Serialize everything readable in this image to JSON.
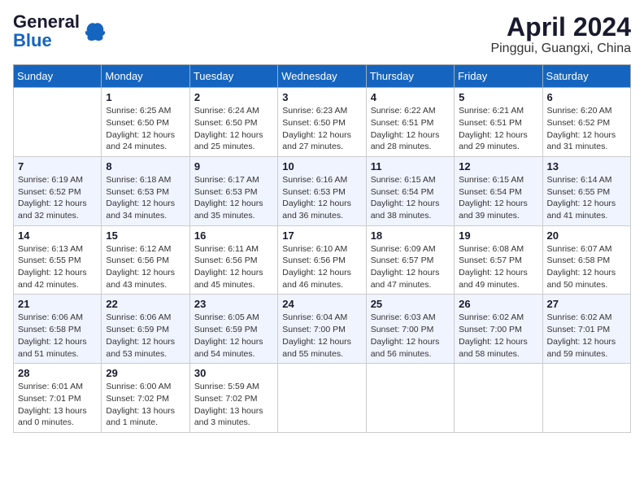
{
  "logo": {
    "general": "General",
    "blue": "Blue"
  },
  "title": {
    "month": "April 2024",
    "location": "Pinggui, Guangxi, China"
  },
  "headers": [
    "Sunday",
    "Monday",
    "Tuesday",
    "Wednesday",
    "Thursday",
    "Friday",
    "Saturday"
  ],
  "weeks": [
    [
      {
        "day": "",
        "info": ""
      },
      {
        "day": "1",
        "info": "Sunrise: 6:25 AM\nSunset: 6:50 PM\nDaylight: 12 hours\nand 24 minutes."
      },
      {
        "day": "2",
        "info": "Sunrise: 6:24 AM\nSunset: 6:50 PM\nDaylight: 12 hours\nand 25 minutes."
      },
      {
        "day": "3",
        "info": "Sunrise: 6:23 AM\nSunset: 6:50 PM\nDaylight: 12 hours\nand 27 minutes."
      },
      {
        "day": "4",
        "info": "Sunrise: 6:22 AM\nSunset: 6:51 PM\nDaylight: 12 hours\nand 28 minutes."
      },
      {
        "day": "5",
        "info": "Sunrise: 6:21 AM\nSunset: 6:51 PM\nDaylight: 12 hours\nand 29 minutes."
      },
      {
        "day": "6",
        "info": "Sunrise: 6:20 AM\nSunset: 6:52 PM\nDaylight: 12 hours\nand 31 minutes."
      }
    ],
    [
      {
        "day": "7",
        "info": "Sunrise: 6:19 AM\nSunset: 6:52 PM\nDaylight: 12 hours\nand 32 minutes."
      },
      {
        "day": "8",
        "info": "Sunrise: 6:18 AM\nSunset: 6:53 PM\nDaylight: 12 hours\nand 34 minutes."
      },
      {
        "day": "9",
        "info": "Sunrise: 6:17 AM\nSunset: 6:53 PM\nDaylight: 12 hours\nand 35 minutes."
      },
      {
        "day": "10",
        "info": "Sunrise: 6:16 AM\nSunset: 6:53 PM\nDaylight: 12 hours\nand 36 minutes."
      },
      {
        "day": "11",
        "info": "Sunrise: 6:15 AM\nSunset: 6:54 PM\nDaylight: 12 hours\nand 38 minutes."
      },
      {
        "day": "12",
        "info": "Sunrise: 6:15 AM\nSunset: 6:54 PM\nDaylight: 12 hours\nand 39 minutes."
      },
      {
        "day": "13",
        "info": "Sunrise: 6:14 AM\nSunset: 6:55 PM\nDaylight: 12 hours\nand 41 minutes."
      }
    ],
    [
      {
        "day": "14",
        "info": "Sunrise: 6:13 AM\nSunset: 6:55 PM\nDaylight: 12 hours\nand 42 minutes."
      },
      {
        "day": "15",
        "info": "Sunrise: 6:12 AM\nSunset: 6:56 PM\nDaylight: 12 hours\nand 43 minutes."
      },
      {
        "day": "16",
        "info": "Sunrise: 6:11 AM\nSunset: 6:56 PM\nDaylight: 12 hours\nand 45 minutes."
      },
      {
        "day": "17",
        "info": "Sunrise: 6:10 AM\nSunset: 6:56 PM\nDaylight: 12 hours\nand 46 minutes."
      },
      {
        "day": "18",
        "info": "Sunrise: 6:09 AM\nSunset: 6:57 PM\nDaylight: 12 hours\nand 47 minutes."
      },
      {
        "day": "19",
        "info": "Sunrise: 6:08 AM\nSunset: 6:57 PM\nDaylight: 12 hours\nand 49 minutes."
      },
      {
        "day": "20",
        "info": "Sunrise: 6:07 AM\nSunset: 6:58 PM\nDaylight: 12 hours\nand 50 minutes."
      }
    ],
    [
      {
        "day": "21",
        "info": "Sunrise: 6:06 AM\nSunset: 6:58 PM\nDaylight: 12 hours\nand 51 minutes."
      },
      {
        "day": "22",
        "info": "Sunrise: 6:06 AM\nSunset: 6:59 PM\nDaylight: 12 hours\nand 53 minutes."
      },
      {
        "day": "23",
        "info": "Sunrise: 6:05 AM\nSunset: 6:59 PM\nDaylight: 12 hours\nand 54 minutes."
      },
      {
        "day": "24",
        "info": "Sunrise: 6:04 AM\nSunset: 7:00 PM\nDaylight: 12 hours\nand 55 minutes."
      },
      {
        "day": "25",
        "info": "Sunrise: 6:03 AM\nSunset: 7:00 PM\nDaylight: 12 hours\nand 56 minutes."
      },
      {
        "day": "26",
        "info": "Sunrise: 6:02 AM\nSunset: 7:00 PM\nDaylight: 12 hours\nand 58 minutes."
      },
      {
        "day": "27",
        "info": "Sunrise: 6:02 AM\nSunset: 7:01 PM\nDaylight: 12 hours\nand 59 minutes."
      }
    ],
    [
      {
        "day": "28",
        "info": "Sunrise: 6:01 AM\nSunset: 7:01 PM\nDaylight: 13 hours\nand 0 minutes."
      },
      {
        "day": "29",
        "info": "Sunrise: 6:00 AM\nSunset: 7:02 PM\nDaylight: 13 hours\nand 1 minute."
      },
      {
        "day": "30",
        "info": "Sunrise: 5:59 AM\nSunset: 7:02 PM\nDaylight: 13 hours\nand 3 minutes."
      },
      {
        "day": "",
        "info": ""
      },
      {
        "day": "",
        "info": ""
      },
      {
        "day": "",
        "info": ""
      },
      {
        "day": "",
        "info": ""
      }
    ]
  ]
}
